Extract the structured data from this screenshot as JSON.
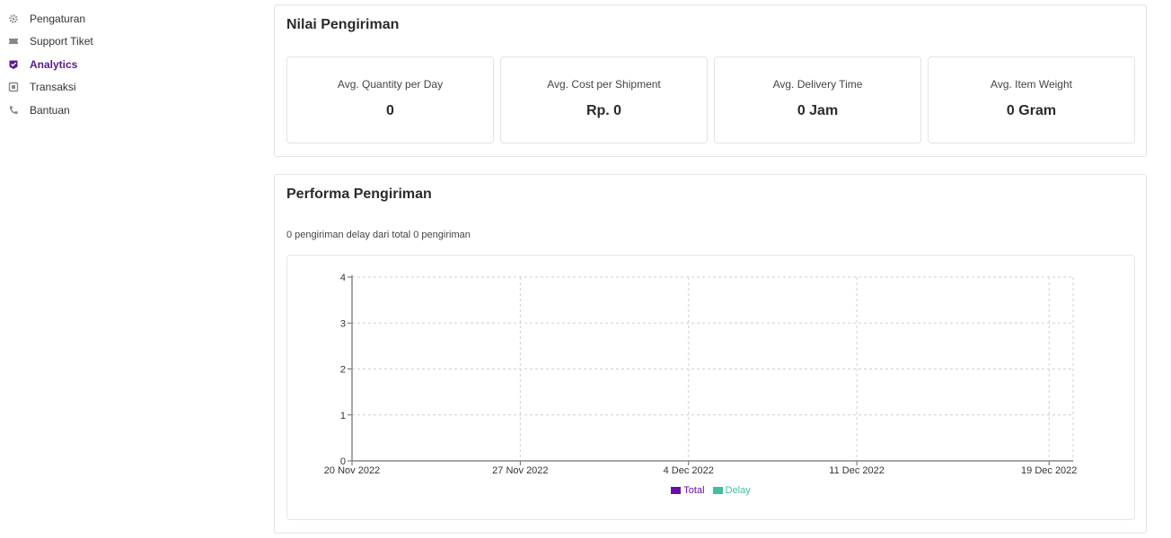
{
  "sidebar": {
    "items": [
      {
        "label": "Pengaturan",
        "icon": "gear-icon",
        "active": false
      },
      {
        "label": "Support Tiket",
        "icon": "ticket-icon",
        "active": false
      },
      {
        "label": "Analytics",
        "icon": "analytics-icon",
        "active": true
      },
      {
        "label": "Transaksi",
        "icon": "receipt-icon",
        "active": false
      },
      {
        "label": "Bantuan",
        "icon": "phone-icon",
        "active": false
      }
    ]
  },
  "nilai": {
    "title": "Nilai Pengiriman",
    "cards": [
      {
        "label": "Avg. Quantity per Day",
        "value": "0"
      },
      {
        "label": "Avg. Cost per Shipment",
        "value": "Rp. 0"
      },
      {
        "label": "Avg. Delivery Time",
        "value": "0 Jam"
      },
      {
        "label": "Avg. Item Weight",
        "value": "0 Gram"
      }
    ]
  },
  "performa": {
    "title": "Performa Pengiriman",
    "summary": "0 pengiriman delay dari total 0 pengiriman"
  },
  "colors": {
    "accent": "#5a1a8c",
    "total": "#6a0dad",
    "delay": "#3fbfa0"
  },
  "chart_data": {
    "type": "line",
    "x_ticks": [
      "20 Nov 2022",
      "27 Nov 2022",
      "4 Dec 2022",
      "11 Dec 2022",
      "19 Dec 2022"
    ],
    "y_ticks": [
      0,
      1,
      2,
      3,
      4
    ],
    "ylim": [
      0,
      4
    ],
    "xlim": [
      "2022-11-20",
      "2022-12-20"
    ],
    "grid": true,
    "legend_position": "bottom",
    "series": [
      {
        "name": "Total",
        "color": "#6a0dad",
        "values": []
      },
      {
        "name": "Delay",
        "color": "#3fbfa0",
        "values": []
      }
    ]
  }
}
